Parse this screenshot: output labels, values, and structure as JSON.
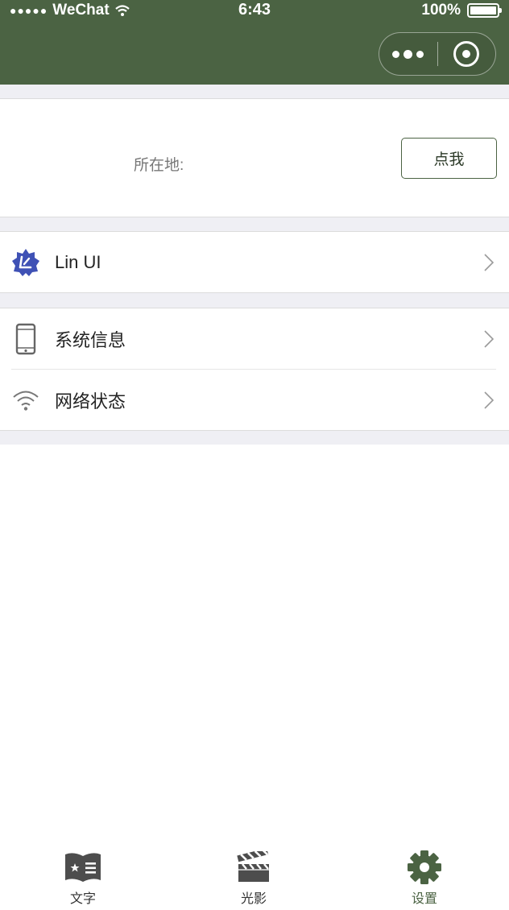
{
  "status_bar": {
    "carrier": "WeChat",
    "time": "6:43",
    "battery": "100%"
  },
  "location": {
    "label": "所在地:",
    "button": "点我"
  },
  "list_groups": [
    {
      "items": [
        {
          "label": "Lin UI",
          "icon": "lin-ui-logo-icon"
        }
      ]
    },
    {
      "items": [
        {
          "label": "系统信息",
          "icon": "phone-icon"
        },
        {
          "label": "网络状态",
          "icon": "wifi-icon"
        }
      ]
    }
  ],
  "tabbar": {
    "tabs": [
      {
        "label": "文字",
        "icon": "book-icon"
      },
      {
        "label": "光影",
        "icon": "clapperboard-icon"
      },
      {
        "label": "设置",
        "icon": "gear-icon",
        "active": true
      }
    ]
  },
  "colors": {
    "nav_bg": "#4b6343",
    "accent": "#4b6343",
    "separator": "#efeff4",
    "lin_ui_blue": "#3f51b5"
  }
}
